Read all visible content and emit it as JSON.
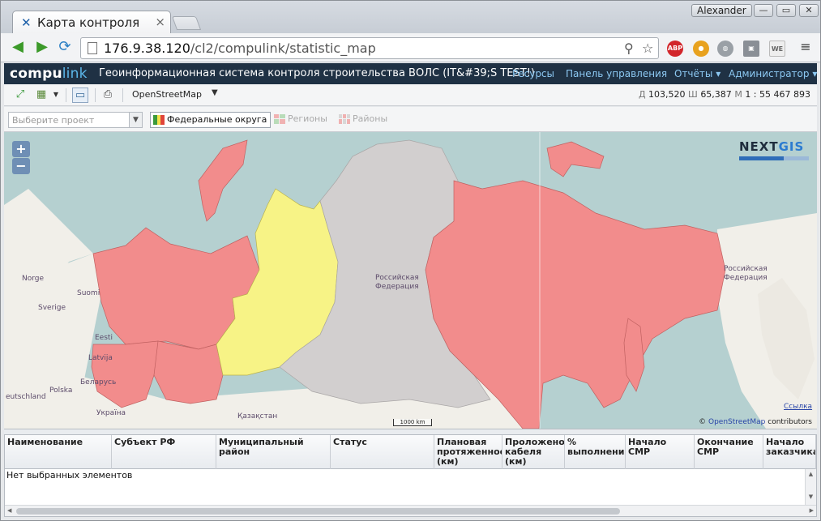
{
  "browser": {
    "tab_title": "Карта контроля",
    "user": "Alexander",
    "url_host": "176.9.38.120",
    "url_path": "/cl2/compulink/statistic_map",
    "ext_abp": "ABP",
    "ext_we": "WE"
  },
  "app": {
    "logo_main": "compu",
    "logo_accent": "link",
    "title": "Геоинформационная система контроля строительства ВОЛС (IT&#39;S TEST!)",
    "menu": [
      "Ресурсы",
      "Панель управления",
      "Отчёты ▾",
      "Администратор ▾"
    ]
  },
  "map_toolbar": {
    "layer": "OpenStreetMap",
    "lat_label": "Д",
    "lat": "103,520",
    "lon_label": "Ш",
    "lon": "65,387",
    "scale_label": "М",
    "scale": "1 : 55 467 893"
  },
  "filter": {
    "project_placeholder": "Выберите проект",
    "federal": "Федеральные округа",
    "regions": "Регионы",
    "districts": "Районы"
  },
  "map": {
    "zoom_in": "+",
    "zoom_out": "−",
    "brand_a": "NEXT",
    "brand_b": "GIS",
    "labels": [
      "Norge",
      "Suomi",
      "Sverige",
      "Eesti",
      "Latvija",
      "Беларусь",
      "Polska",
      "eutschland",
      "Україна",
      "Қазақстан",
      "Российская",
      "Федерация",
      "Российская",
      "Федерация"
    ],
    "link_text": "Ссылка",
    "attribution_osm": "OpenStreetMap",
    "attribution_rest": "contributors",
    "scalebar": "1000 km",
    "colors": {
      "federal_red": "#f28c8c",
      "federal_yellow": "#f7f386",
      "other_gray": "#d2cfcf",
      "water": "#b5d0d0",
      "land": "#f1efe9"
    }
  },
  "grid": {
    "columns": [
      "Наименование",
      "Субъект РФ",
      "Муниципальный район",
      "Статус",
      "Плановая протяженность (км)",
      "Проложено кабеля (км)",
      "% выполнения",
      "Начало СМР",
      "Окончание СМР",
      "Начало заказчика"
    ],
    "empty_text": "Нет выбранных элементов"
  }
}
